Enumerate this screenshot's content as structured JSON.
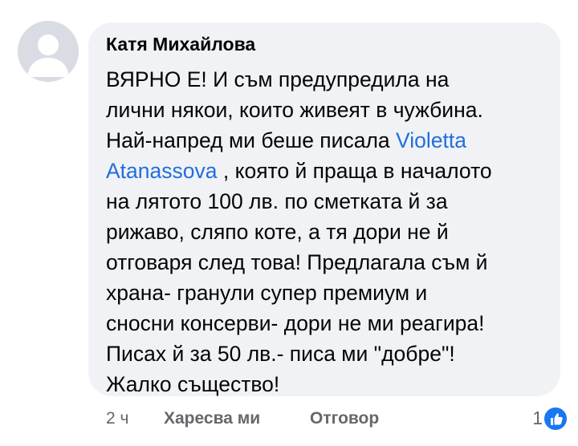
{
  "comment": {
    "author": "Катя Михайлова",
    "avatar_icon": "default-user-avatar-icon",
    "lines": [
      "ВЯРНО Е! И съм предупредила на",
      "лични някои, които живеят в чужбина.",
      "Най-напред ми беше писала ",
      "Atanassova",
      " , която й праща в началото",
      "на лятото 100 лв. по сметката й за",
      "рижаво, сляпо коте, а тя дори не й",
      "отговаря след това! Предлагала съм й",
      "храна- гранули супер премиум и",
      "сносни консерви- дори не ми реагира!",
      "Писах й за 50 лв.- писа ми \"добре\"!",
      "Жалко същество!"
    ],
    "mention_first": "Violetta",
    "bubble_color": "#f0f2f5",
    "mention_color": "#216fdb"
  },
  "actions": {
    "timestamp": "2 ч",
    "like_label": "Харесва ми",
    "reply_label": "Отговор",
    "reaction_count": "1",
    "reaction_icon": "thumbs-up-icon",
    "reaction_color": "#1877f2"
  }
}
